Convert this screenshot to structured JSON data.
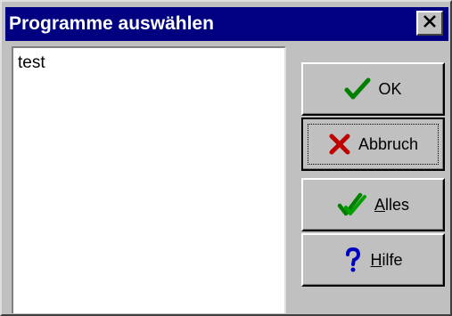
{
  "window": {
    "title": "Programme auswählen",
    "close_symbol": "×"
  },
  "list": {
    "items": [
      "test"
    ]
  },
  "buttons": {
    "ok": {
      "label": "OK",
      "icon": "checkmark-icon",
      "color": "#008000"
    },
    "abbruch": {
      "label": "Abbruch",
      "icon": "x-cross-icon",
      "color": "#c00000"
    },
    "alles": {
      "label_mnemonic": "A",
      "label_rest": "lles",
      "icon": "double-checkmark-icon",
      "color": "#008000"
    },
    "hilfe": {
      "label_mnemonic": "H",
      "label_rest": "ilfe",
      "icon": "question-mark-icon",
      "color": "#0000c0"
    }
  }
}
